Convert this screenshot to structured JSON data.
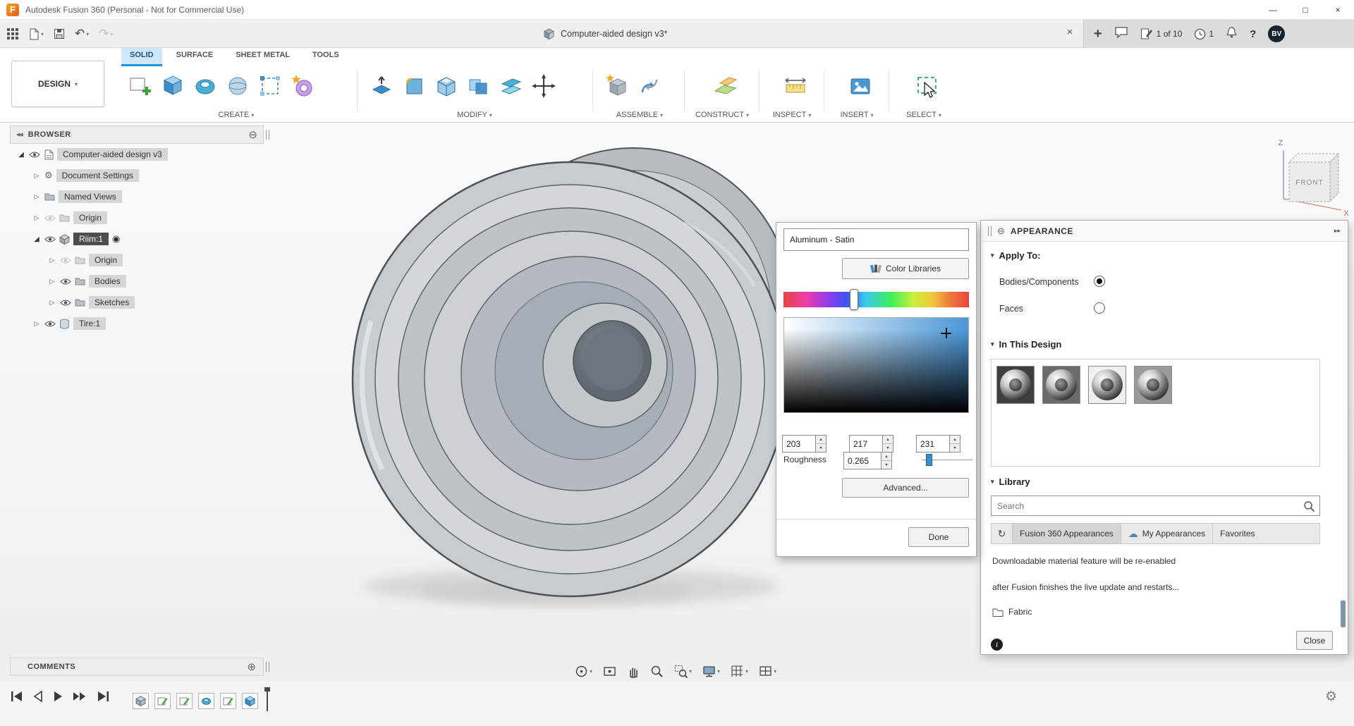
{
  "window": {
    "title": "Autodesk Fusion 360 (Personal - Not for Commercial Use)"
  },
  "quick_access": {
    "document_tab": "Computer-aided design v3*",
    "page_indicator": "1 of 10",
    "job_status_count": "1",
    "avatar_initials": "BV"
  },
  "ribbon": {
    "workspace_label": "DESIGN",
    "tabs": [
      {
        "label": "SOLID",
        "active": true
      },
      {
        "label": "SURFACE",
        "active": false
      },
      {
        "label": "SHEET METAL",
        "active": false
      },
      {
        "label": "TOOLS",
        "active": false
      }
    ],
    "groups": [
      {
        "label": "CREATE"
      },
      {
        "label": "MODIFY"
      },
      {
        "label": "ASSEMBLE"
      },
      {
        "label": "CONSTRUCT"
      },
      {
        "label": "INSPECT"
      },
      {
        "label": "INSERT"
      },
      {
        "label": "SELECT"
      }
    ]
  },
  "browser": {
    "title": "BROWSER",
    "items": [
      {
        "label": "Computer-aided design v3",
        "level": 0,
        "icon": "document",
        "expanded": true,
        "visible": true
      },
      {
        "label": "Document Settings",
        "level": 1,
        "icon": "gear",
        "expanded": false
      },
      {
        "label": "Named Views",
        "level": 1,
        "icon": "folder",
        "expanded": false
      },
      {
        "label": "Origin",
        "level": 1,
        "icon": "folder",
        "expanded": false,
        "visible": false
      },
      {
        "label": "Riim:1",
        "level": 1,
        "icon": "component",
        "expanded": true,
        "selected": true,
        "activated": true,
        "visible": true
      },
      {
        "label": "Origin",
        "level": 2,
        "icon": "folder",
        "expanded": false,
        "visible": false
      },
      {
        "label": "Bodies",
        "level": 2,
        "icon": "folder",
        "expanded": false,
        "visible": true
      },
      {
        "label": "Sketches",
        "level": 2,
        "icon": "folder",
        "expanded": false,
        "visible": true
      },
      {
        "label": "Tire:1",
        "level": 1,
        "icon": "body",
        "expanded": false,
        "visible": true
      }
    ]
  },
  "viewcube": {
    "front_label": "FRONT",
    "z_axis_label": "Z",
    "x_axis_label": "X"
  },
  "color_dialog": {
    "name_value": "Aluminum - Satin",
    "color_libraries_label": "Color Libraries",
    "r": "203",
    "g": "217",
    "b": "231",
    "roughness_label": "Roughness",
    "roughness_value": "0.265",
    "advanced_label": "Advanced...",
    "done_label": "Done"
  },
  "appearance": {
    "title": "APPEARANCE",
    "apply_to_label": "Apply To:",
    "apply_options": [
      {
        "label": "Bodies/Components",
        "selected": true
      },
      {
        "label": "Faces",
        "selected": false
      }
    ],
    "in_this_design_label": "In This Design",
    "library_label": "Library",
    "search_placeholder": "Search",
    "library_tabs": [
      {
        "label": "Fusion 360 Appearances",
        "active": true
      },
      {
        "label": "My Appearances",
        "active": false
      },
      {
        "label": "Favorites",
        "active": false
      }
    ],
    "notice_line1": "Downloadable material feature will be re-enabled",
    "notice_line2": "after Fusion finishes the live update and restarts...",
    "category_item": "Fabric",
    "close_label": "Close"
  },
  "comments": {
    "title": "COMMENTS"
  },
  "colors": {
    "accent_blue": "#1a96d5",
    "selection_dark": "#4d4d4d",
    "picked_rgb": "rgb(203,217,231)"
  },
  "icons": {
    "caret_down": "▾",
    "spin_up": "▲",
    "spin_down": "▼",
    "undo": "↶",
    "redo": "↷",
    "close": "×",
    "plus": "+",
    "window_minimize": "—",
    "window_maximize": "□",
    "window_close": "×",
    "collapse_double_left": "◀◀",
    "circle_minus": "⊖",
    "circle_plus": "⊕",
    "tree_expanded": "◢",
    "tree_collapsed": "▷",
    "double_arrow_right": "▸▸",
    "refresh": "↻",
    "cloud": "☁",
    "gear": "⚙",
    "help": "?",
    "radio_target": "◉",
    "star": "★"
  }
}
